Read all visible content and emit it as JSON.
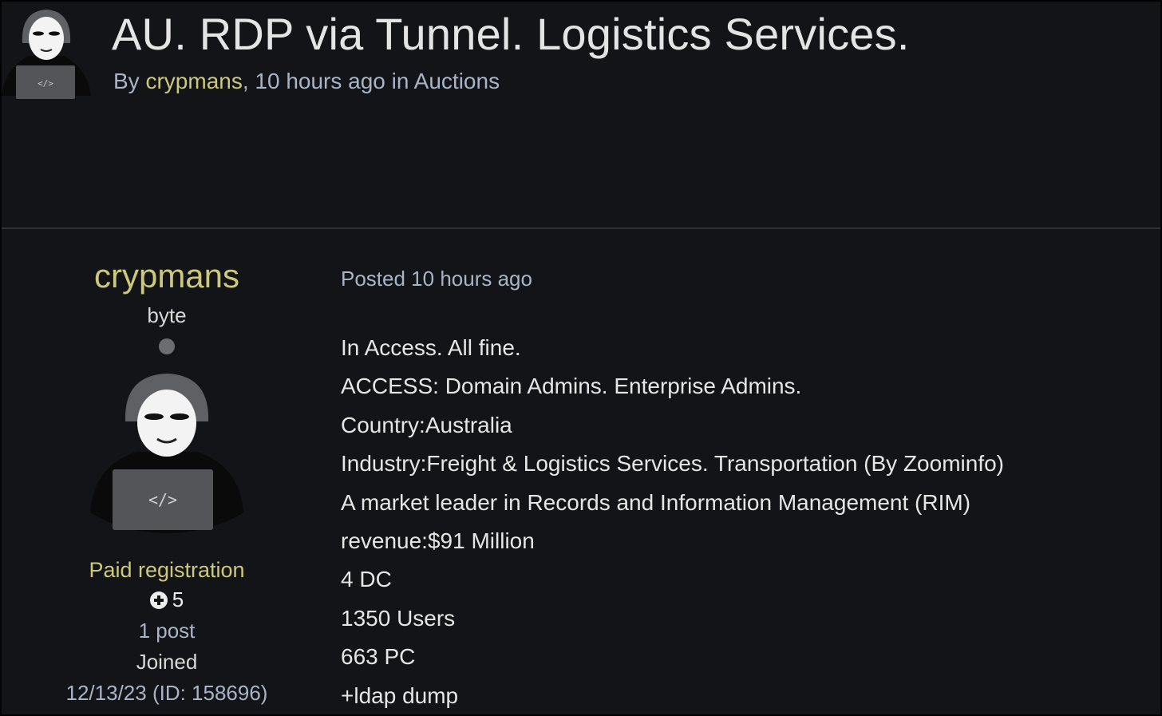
{
  "thread": {
    "title": "AU. RDP via Tunnel. Logistics Services.",
    "byline_prefix": "By ",
    "author": "crypmans",
    "byline_suffix": ", 10 hours ago in Auctions"
  },
  "profile": {
    "username": "crypmans",
    "rank": "byte",
    "group": "Paid registration",
    "reputation": "5",
    "posts": "1 post",
    "joined_label": "Joined",
    "joined_date": "12/13/23 (ID: 158696)",
    "avatar_icon": "hacker-avatar-icon",
    "avatar_laptop_text": "</>"
  },
  "post": {
    "meta": "Posted 10 hours ago",
    "lines": [
      "In Access. All fine.",
      "ACCESS: Domain Admins. Enterprise Admins.",
      "Country:Australia",
      "Industry:Freight & Logistics Services. Transportation (By Zoominfo)",
      "A market leader in Records and Information Management (RIM)",
      "revenue:$91 Million",
      "4 DC",
      "1350 Users",
      "663 PC",
      "+ldap dump"
    ]
  },
  "colors": {
    "background": "#131417",
    "username_accent": "#cdc97a",
    "muted_link": "#a9b4c7",
    "body_text": "#e6e6e6",
    "divider": "#2e3033"
  }
}
